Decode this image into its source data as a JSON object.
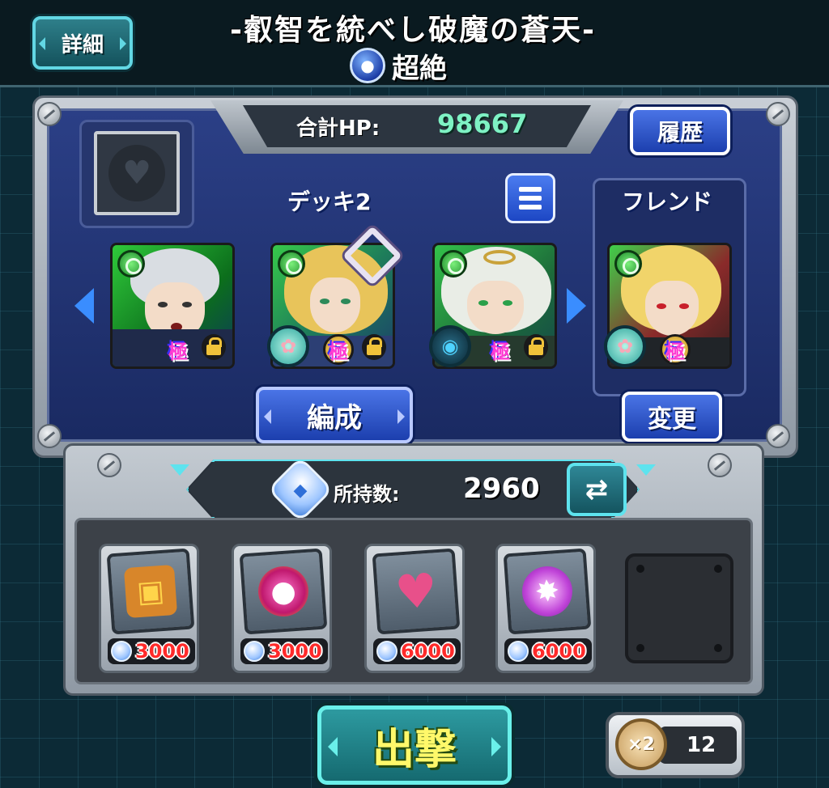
{
  "header": {
    "detail_label": "詳細",
    "quest_title": "-叡智を統べし破魔の蒼天-",
    "difficulty": "超絶"
  },
  "team": {
    "total_hp_label": "合計HP:",
    "total_hp_value": "98667",
    "history_label": "履歴",
    "deck_label": "デッキ2",
    "friend_label": "フレンド",
    "formation_label": "編成",
    "change_label": "変更",
    "goku_badge": "極"
  },
  "stock": {
    "label": "所持数:",
    "value": "2960"
  },
  "items": [
    {
      "name": "treasure-chest",
      "cost": "3000"
    },
    {
      "name": "speed-orb",
      "cost": "3000"
    },
    {
      "name": "heart-plus",
      "cost": "6000"
    },
    {
      "name": "magic-burst",
      "cost": "6000"
    }
  ],
  "sortie_label": "出撃",
  "boost": {
    "multiplier": "×2",
    "count": "12"
  },
  "colors": {
    "accent_cyan": "#5ee3ee",
    "button_blue": "#1c3fae",
    "hp_value": "#7ef2c4",
    "cost_red": "#ff2a2a",
    "sortie_text": "#fff86a"
  }
}
